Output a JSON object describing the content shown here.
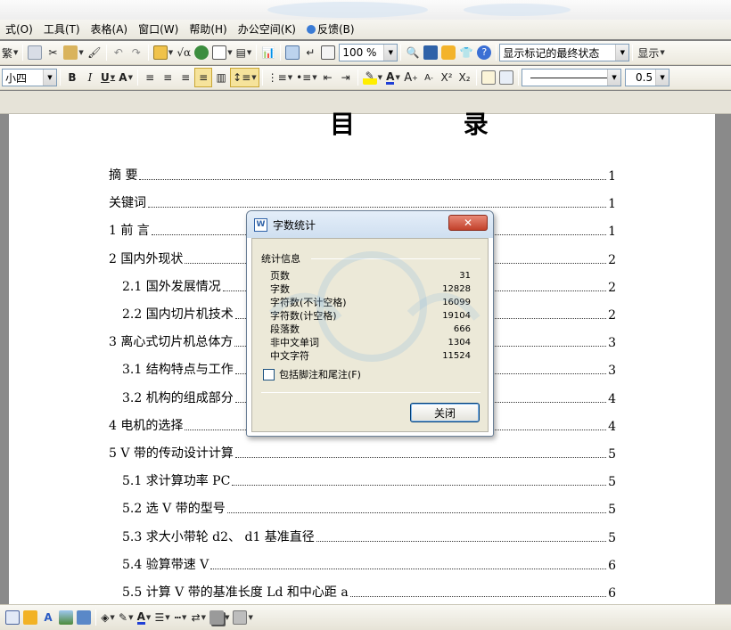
{
  "menu": [
    "式(O)",
    "工具(T)",
    "表格(A)",
    "窗口(W)",
    "帮助(H)",
    "办公空间(K)",
    "反馈(B)"
  ],
  "toolbar1": {
    "trad_label": "繁",
    "zoom": "100 %",
    "markup_state": "显示标记的最终状态",
    "show_label": "显示"
  },
  "toolbar2": {
    "font_size": "小四",
    "bold": "B",
    "italic": "I",
    "underline": "U",
    "char_scale": "A",
    "grow_font": "A",
    "shrink_font": "A",
    "superscript": "X²",
    "subscript": "X₂",
    "line_width": "0.5"
  },
  "document": {
    "title": "目 录",
    "toc": [
      {
        "text": "摘  要",
        "page": "1",
        "indent": 0
      },
      {
        "text": "关键词",
        "page": "1",
        "indent": 0
      },
      {
        "text": "1 前  言",
        "page": "1",
        "indent": 0
      },
      {
        "text": "2 国内外现状",
        "page": "2",
        "indent": 0
      },
      {
        "text": "2.1 国外发展情况",
        "page": "2",
        "indent": 1
      },
      {
        "text": "2.2 国内切片机技术",
        "page": "2",
        "indent": 1
      },
      {
        "text": "3 离心式切片机总体方",
        "page": "3",
        "indent": 0
      },
      {
        "text": "3.1 结构特点与工作",
        "page": "3",
        "indent": 1
      },
      {
        "text": "3.2 机构的组成部分",
        "page": "4",
        "indent": 1
      },
      {
        "text": "4 电机的选择",
        "page": "4",
        "indent": 0
      },
      {
        "text": "5 V 带的传动设计计算",
        "page": "5",
        "indent": 0
      },
      {
        "text": "5.1 求计算功率 PC",
        "page": "5",
        "indent": 1
      },
      {
        "text": "5.2 选 V 带的型号",
        "page": "5",
        "indent": 1
      },
      {
        "text": "5.3 求大小带轮 d2、 d1 基准直径",
        "page": "5",
        "indent": 1
      },
      {
        "text": "5.4 验算带速 V",
        "page": "6",
        "indent": 1
      },
      {
        "text": "5.5 计算 V 带的基准长度 Ld 和中心距 a",
        "page": "6",
        "indent": 1
      }
    ]
  },
  "dialog": {
    "title": "字数统计",
    "close_glyph": "✕",
    "group_label": "统计信息",
    "stats": [
      {
        "label": "页数",
        "value": "31"
      },
      {
        "label": "字数",
        "value": "12828"
      },
      {
        "label": "字符数(不计空格)",
        "value": "16099"
      },
      {
        "label": "字符数(计空格)",
        "value": "19104"
      },
      {
        "label": "段落数",
        "value": "666"
      },
      {
        "label": "非中文单词",
        "value": "1304"
      },
      {
        "label": "中文字符",
        "value": "11524"
      }
    ],
    "checkbox_label": "包括脚注和尾注(F)",
    "close_button": "关闭"
  }
}
